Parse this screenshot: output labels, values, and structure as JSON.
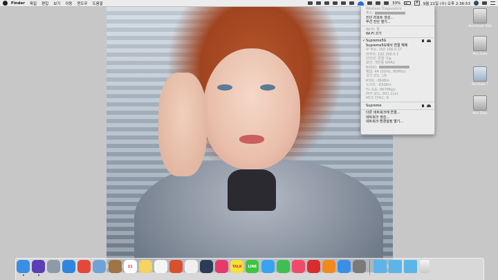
{
  "menubar": {
    "app": "Finder",
    "menus": [
      "파일",
      "편집",
      "보기",
      "이동",
      "윈도우",
      "도움말"
    ],
    "battery": "33%",
    "input_method": "A",
    "clock": "9월 21일 (수) 오후 2:36:53"
  },
  "wifi_menu": {
    "header": [
      {
        "text": "Wireless Diagnostics",
        "dim": true
      },
      {
        "text": "주소:",
        "dim": true,
        "redacted": true
      },
      {
        "text": "진단 리포트 생성...",
        "dim": false
      },
      {
        "text": "무선 진단 열기...",
        "dim": false
      }
    ],
    "power": [
      {
        "text": "Wi-Fi: 켬",
        "dim": true
      },
      {
        "text": "Wi-Fi 끄기",
        "dim": false
      }
    ],
    "connected": {
      "name": "Supreme5G",
      "disconnect": "Supreme5G에서 연결 해제",
      "details": [
        "IP 주소: 192.168.0.17",
        "라우터: 192.168.0.1",
        "인터넷: 연결 가능",
        "보안: 개인용 WPA2",
        "BSSID:",
        "채널: 44 (5GHz, 80MHz)",
        "국가 코드: US",
        "RSSI: -38dBm",
        "노이즈: -83dBm",
        "Tx 속도: 867Mbps",
        "PHY 모드: 802.11ac",
        "MCS 인덱스: 9"
      ]
    },
    "other_network": "Supreme",
    "footer": [
      "다른 네트워크에 연결...",
      "네트워크 생성...",
      "네트워크 환경설정 열기..."
    ]
  },
  "desktop_icons": [
    "Macintosh SSD",
    "Mac Data",
    "Windows 7",
    "Mac Data"
  ],
  "dock": {
    "apps": [
      {
        "name": "finder",
        "color": "#3a8ee6",
        "label": ""
      },
      {
        "name": "siri",
        "color": "#5b3fb5",
        "label": ""
      },
      {
        "name": "launchpad",
        "color": "#8e9aa8",
        "label": ""
      },
      {
        "name": "safari",
        "color": "#2f86e0",
        "label": ""
      },
      {
        "name": "chrome",
        "color": "#e6473b",
        "label": ""
      },
      {
        "name": "preview",
        "color": "#6fa3d8",
        "label": ""
      },
      {
        "name": "contacts",
        "color": "#a07444",
        "label": ""
      },
      {
        "name": "calendar",
        "color": "#ffffff",
        "label": "21"
      },
      {
        "name": "notes",
        "color": "#f4d35e",
        "label": ""
      },
      {
        "name": "reminders",
        "color": "#f5f5f5",
        "label": ""
      },
      {
        "name": "photo-booth",
        "color": "#d9502f",
        "label": ""
      },
      {
        "name": "photos",
        "color": "#f0f0f0",
        "label": ""
      },
      {
        "name": "quicktime",
        "color": "#2d3c55",
        "label": ""
      },
      {
        "name": "screenshot",
        "color": "#e63b6a",
        "label": ""
      },
      {
        "name": "kakaotalk",
        "color": "#f7e13a",
        "label": "TALK"
      },
      {
        "name": "line",
        "color": "#3ec43e",
        "label": "LINE"
      },
      {
        "name": "messages",
        "color": "#36a4f0",
        "label": ""
      },
      {
        "name": "facetime",
        "color": "#3fbf4f",
        "label": ""
      },
      {
        "name": "music",
        "color": "#f04a6a",
        "label": ""
      },
      {
        "name": "netease",
        "color": "#d92c2c",
        "label": ""
      },
      {
        "name": "books",
        "color": "#f08a1e",
        "label": ""
      },
      {
        "name": "app-store",
        "color": "#3a8ee6",
        "label": ""
      },
      {
        "name": "system-preferences",
        "color": "#7a7a7a",
        "label": ""
      }
    ],
    "folders": [
      {
        "name": "applications-folder",
        "color": "#5cb5ea"
      },
      {
        "name": "documents-folder",
        "color": "#5cb5ea"
      },
      {
        "name": "downloads-folder",
        "color": "#5cb5ea"
      }
    ]
  }
}
